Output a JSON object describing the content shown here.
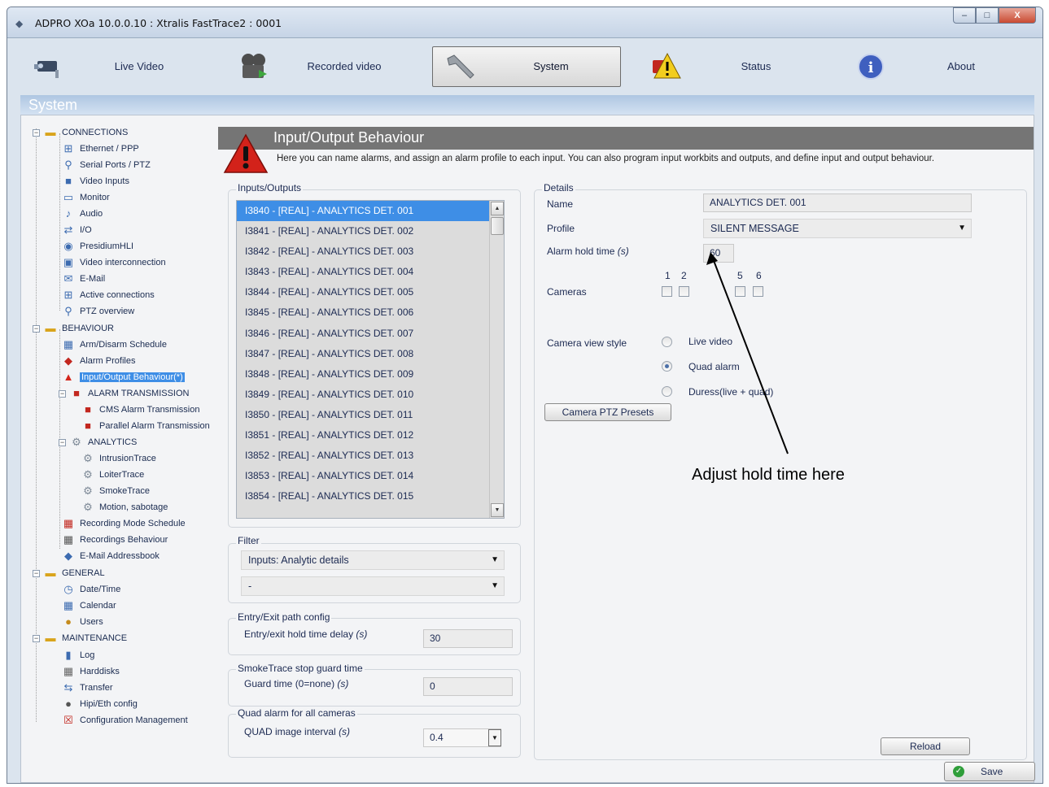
{
  "window": {
    "title": "ADPRO XOa 10.0.0.10 : Xtralis FastTrace2 : 0001",
    "controls": {
      "minimize": "‒",
      "maximize": "□",
      "close": "X"
    }
  },
  "nav": [
    {
      "label": "Live Video",
      "icon": "camera-icon"
    },
    {
      "label": "Recorded video",
      "icon": "film-reel-icon"
    },
    {
      "label": "System",
      "icon": "wrench-icon"
    },
    {
      "label": "Status",
      "icon": "alarm-status-icon"
    },
    {
      "label": "About",
      "icon": "info-icon"
    }
  ],
  "section": {
    "title": "System"
  },
  "tree": {
    "connections": "CONNECTIONS",
    "ethernet": "Ethernet / PPP",
    "serial": "Serial Ports / PTZ",
    "video_inputs": "Video Inputs",
    "monitor": "Monitor",
    "audio": "Audio",
    "io": "I/O",
    "presidium": "PresidiumHLI",
    "video_interconnection": "Video interconnection",
    "email": "E-Mail",
    "active_connections": "Active connections",
    "ptz_overview": "PTZ overview",
    "behaviour": "BEHAVIOUR",
    "arm_disarm": "Arm/Disarm Schedule",
    "alarm_profiles": "Alarm Profiles",
    "io_behaviour": "Input/Output Behaviour(*)",
    "alarm_transmission": "ALARM TRANSMISSION",
    "cms": "CMS Alarm Transmission",
    "parallel": "Parallel Alarm Transmission",
    "analytics": "ANALYTICS",
    "intrusion": "IntrusionTrace",
    "loiter": "LoiterTrace",
    "smoke": "SmokeTrace",
    "motion": "Motion, sabotage",
    "recording_mode": "Recording Mode Schedule",
    "recordings_behaviour": "Recordings Behaviour",
    "email_addressbook": "E-Mail Addressbook",
    "general": "GENERAL",
    "datetime": "Date/Time",
    "calendar": "Calendar",
    "users": "Users",
    "maintenance": "MAINTENANCE",
    "log": "Log",
    "harddisks": "Harddisks",
    "transfer": "Transfer",
    "hipi": "Hipi/Eth config",
    "config_mgmt": "Configuration Management"
  },
  "io": {
    "title": "Input/Output Behaviour",
    "description": "Here you can name alarms, and assign an alarm profile to each input. You can also program input workbits and outputs, and define input and output behaviour."
  },
  "inputs_outputs": {
    "label": "Inputs/Outputs",
    "items": [
      "I3840 - [REAL] - ANALYTICS DET. 001",
      "I3841 - [REAL] - ANALYTICS DET. 002",
      "I3842 - [REAL] - ANALYTICS DET. 003",
      "I3843 - [REAL] - ANALYTICS DET. 004",
      "I3844 - [REAL] - ANALYTICS DET. 005",
      "I3845 - [REAL] - ANALYTICS DET. 006",
      "I3846 - [REAL] - ANALYTICS DET. 007",
      "I3847 - [REAL] - ANALYTICS DET. 008",
      "I3848 - [REAL] - ANALYTICS DET. 009",
      "I3849 - [REAL] - ANALYTICS DET. 010",
      "I3850 - [REAL] - ANALYTICS DET. 011",
      "I3851 - [REAL] - ANALYTICS DET. 012",
      "I3852 - [REAL] - ANALYTICS DET. 013",
      "I3853 - [REAL] - ANALYTICS DET. 014",
      "I3854 - [REAL] - ANALYTICS DET. 015"
    ]
  },
  "filter": {
    "label": "Filter",
    "selected": "Inputs: Analytic details",
    "secondary": "-"
  },
  "entry_exit": {
    "label": "Entry/Exit path config",
    "field_label": "Entry/exit hold time delay",
    "unit": "(s)",
    "value": "30"
  },
  "smoke_guard": {
    "label": "SmokeTrace stop guard time",
    "field_label": "Guard time (0=none)",
    "unit": "(s)",
    "value": "0"
  },
  "quad": {
    "label": "Quad alarm for all cameras",
    "field_label": "QUAD image interval",
    "unit": "(s)",
    "value": "0.4"
  },
  "details": {
    "label": "Details",
    "name_label": "Name",
    "name_value": "ANALYTICS DET. 001",
    "profile_label": "Profile",
    "profile_value": "SILENT MESSAGE",
    "hold_label": "Alarm hold time",
    "hold_unit": "(s)",
    "hold_value": "60",
    "cameras_label": "Cameras",
    "camera_numbers": [
      "1",
      "2",
      "5",
      "6"
    ],
    "view_style_label": "Camera view style",
    "view_options": [
      "Live video",
      "Quad alarm",
      "Duress(live + quad)"
    ],
    "view_selected": "Quad alarm",
    "ptz_button": "Camera PTZ Presets",
    "reload_button": "Reload"
  },
  "save_button": "Save",
  "annotation": {
    "text": "Adjust hold time here"
  },
  "colors": {
    "selection": "#3e8ee6",
    "header_gray": "#757575",
    "section_blue": "#aec6e2"
  }
}
